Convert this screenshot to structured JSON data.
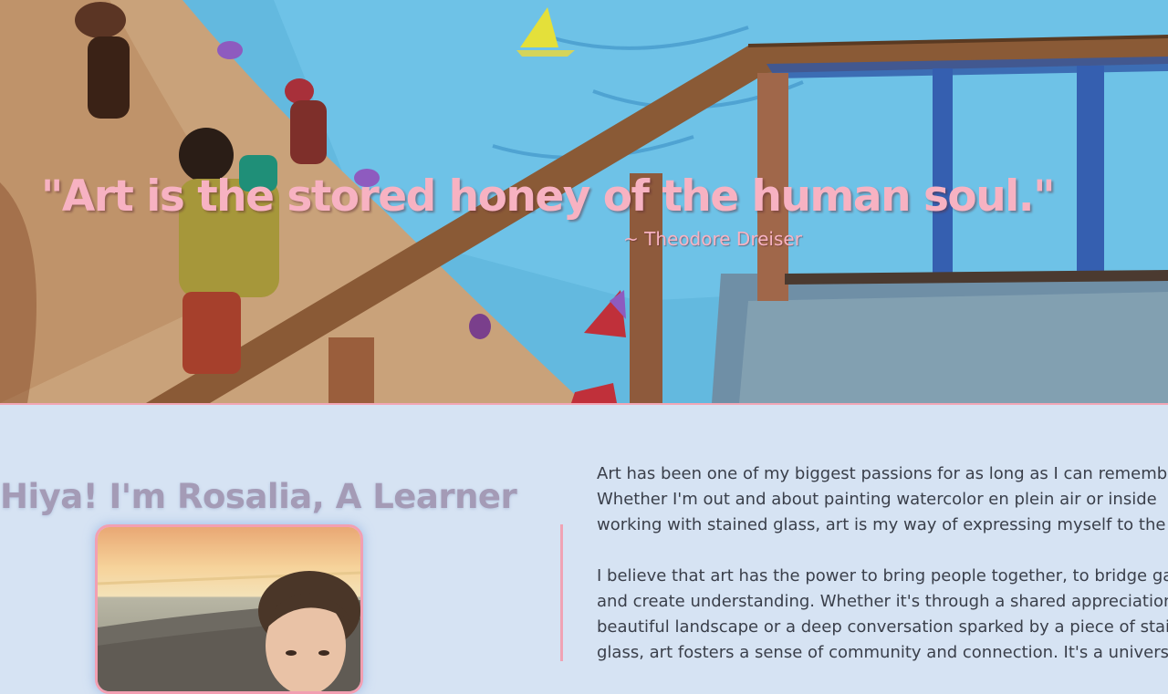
{
  "hero": {
    "quote": "\"Art is the stored honey of the human soul.\"",
    "attribution": "~ Theodore Dreiser"
  },
  "about": {
    "heading": "Hiya! I'm Rosalia, A Learner",
    "photo_alt": "Selfie of Rosalia on a pebble beach at sunset",
    "paragraphs": [
      {
        "lines": [
          "Art has been one of my biggest passions for as long as I can remember.",
          "Whether I'm out and about painting watercolor en plein air or inside",
          "working with stained glass, art is my way of expressing myself to the"
        ]
      },
      {
        "lines": [
          "I believe that art has the power to bring people together, to bridge gaps",
          "and create understanding. Whether it's through a shared appreciation of a",
          "beautiful landscape or a deep conversation sparked by a piece of stained",
          "glass, art fosters a sense of community and connection. It's a universal"
        ]
      }
    ]
  },
  "colors": {
    "page_background": "#d6e3f3",
    "accent_pink": "#f7b2c2",
    "heading_color": "#a49bb6",
    "body_text": "#3a3f4a"
  }
}
